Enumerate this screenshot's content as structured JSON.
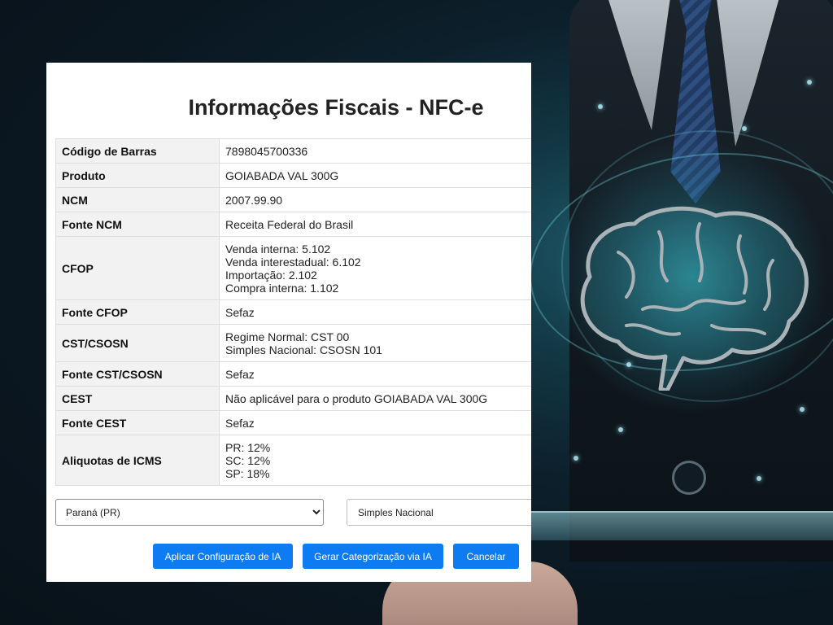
{
  "dialog": {
    "title": "Informações Fiscais - NFC-e"
  },
  "fiscal": {
    "rows": [
      {
        "label": "Código de Barras",
        "values": [
          "7898045700336"
        ]
      },
      {
        "label": "Produto",
        "values": [
          "GOIABADA VAL 300G"
        ]
      },
      {
        "label": "NCM",
        "values": [
          "2007.99.90"
        ]
      },
      {
        "label": "Fonte NCM",
        "values": [
          "Receita Federal do Brasil"
        ]
      },
      {
        "label": "CFOP",
        "values": [
          "Venda interna: 5.102",
          "Venda interestadual: 6.102",
          "Importação: 2.102",
          "Compra interna: 1.102"
        ]
      },
      {
        "label": "Fonte CFOP",
        "values": [
          "Sefaz"
        ]
      },
      {
        "label": "CST/CSOSN",
        "values": [
          "Regime Normal: CST 00",
          "Simples Nacional: CSOSN 101"
        ]
      },
      {
        "label": "Fonte CST/CSOSN",
        "values": [
          "Sefaz"
        ]
      },
      {
        "label": "CEST",
        "values": [
          "Não aplicável para o produto GOIABADA VAL 300G"
        ]
      },
      {
        "label": "Fonte CEST",
        "values": [
          "Sefaz"
        ]
      },
      {
        "label": "Aliquotas de ICMS",
        "values": [
          "PR: 12%",
          "SC: 12%",
          "SP: 18%"
        ]
      }
    ]
  },
  "controls": {
    "state_select": {
      "selected": "Paraná (PR)",
      "options": [
        "Paraná (PR)"
      ]
    },
    "regime_input": {
      "value": "Simples Nacional"
    }
  },
  "buttons": {
    "apply_ai_config": "Aplicar Configuração de IA",
    "generate_ai_categorization": "Gerar Categorização via IA",
    "cancel": "Cancelar"
  },
  "colors": {
    "primary_button": "#0d7cf2",
    "label_cell_bg": "#f2f2f2",
    "table_border": "#dedede"
  }
}
